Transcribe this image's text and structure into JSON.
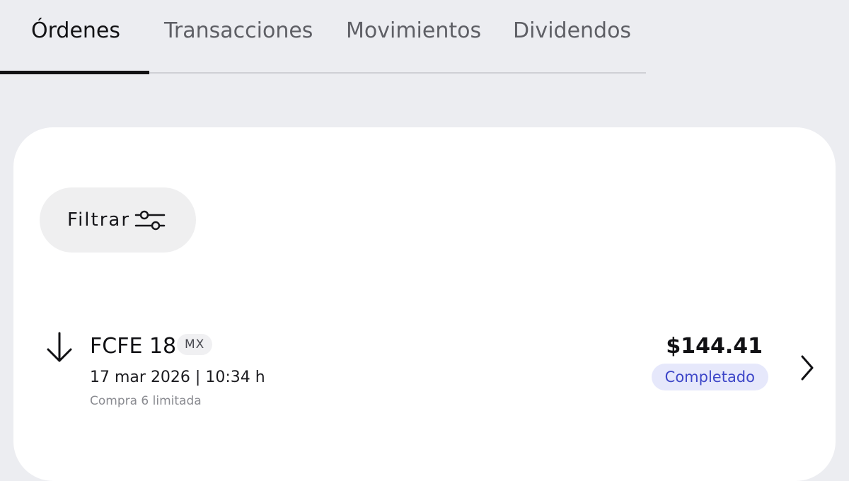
{
  "tabs": [
    {
      "label": "Órdenes",
      "active": true
    },
    {
      "label": "Transacciones",
      "active": false
    },
    {
      "label": "Movimientos",
      "active": false
    },
    {
      "label": "Dividendos",
      "active": false
    }
  ],
  "filter": {
    "label": "Filtrar",
    "icon": "sliders-icon"
  },
  "orders": [
    {
      "direction_icon": "arrow-down-icon",
      "ticker": "FCFE 18",
      "market": "MX",
      "datetime": "17 mar 2026 | 10:34 h",
      "description": "Compra 6 limitada",
      "amount": "$144.41",
      "status": "Completado",
      "chevron_icon": "chevron-right-icon"
    }
  ],
  "colors": {
    "background": "#ecedf1",
    "card": "#ffffff",
    "status_text": "#3d46c8",
    "status_bg": "#e6e8fb",
    "active_tab": "#121214",
    "inactive_tab": "#5e5f65"
  }
}
